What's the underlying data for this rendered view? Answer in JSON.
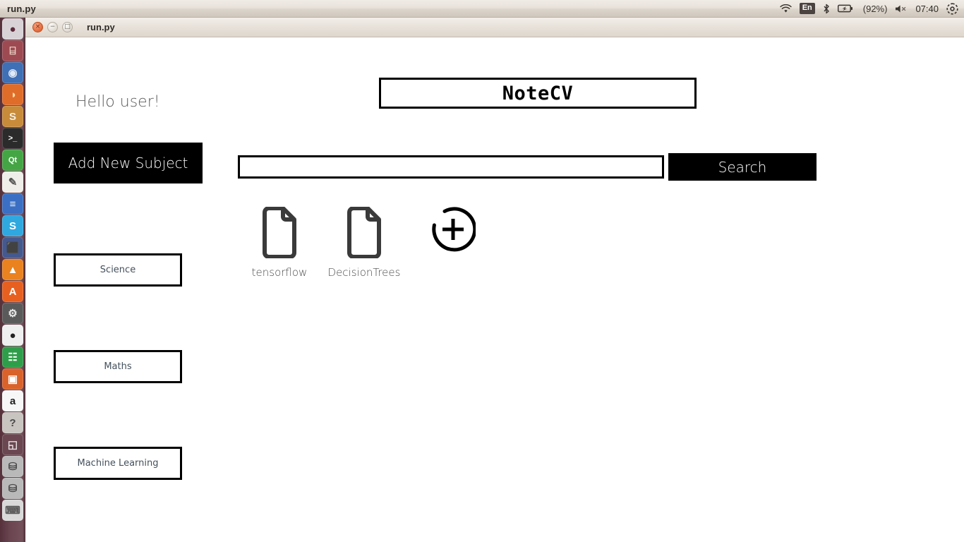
{
  "top_panel": {
    "window_title": "run.py",
    "tray": {
      "wifi_icon": "wifi-icon",
      "keyboard_layout": "En",
      "bluetooth_icon": "bluetooth-icon",
      "battery_icon": "battery-icon",
      "battery_percent": "(92%)",
      "volume_icon": "volume-muted-icon",
      "clock": "07:40",
      "settings_icon": "gear-icon"
    }
  },
  "launcher": {
    "items": [
      {
        "name": "ubuntu-dash",
        "glyph": "●",
        "bg": "#d8d2d6",
        "fg": "#5c2a3a"
      },
      {
        "name": "files-archive",
        "glyph": "⌸",
        "bg": "#9e4a52",
        "fg": "#f3e2d2"
      },
      {
        "name": "chromium-browser",
        "glyph": "◉",
        "bg": "#3f6fb5",
        "fg": "#dfe9f7"
      },
      {
        "name": "firefox-browser",
        "glyph": "◑",
        "bg": "#e06c2a",
        "fg": "#ffd9a0"
      },
      {
        "name": "sublime-text",
        "glyph": "S",
        "bg": "#c88b3a",
        "fg": "#f7efe0"
      },
      {
        "name": "terminal",
        "glyph": ">_",
        "bg": "#2b2b2b",
        "fg": "#ffffff"
      },
      {
        "name": "qt-creator",
        "glyph": "Qt",
        "bg": "#44a544",
        "fg": "#ffffff"
      },
      {
        "name": "text-editor",
        "glyph": "✎",
        "bg": "#f0eee9",
        "fg": "#555555"
      },
      {
        "name": "libreoffice-writer",
        "glyph": "≡",
        "bg": "#3a6fc4",
        "fg": "#eaf1fb"
      },
      {
        "name": "skype",
        "glyph": "S",
        "bg": "#2fa8e0",
        "fg": "#ffffff"
      },
      {
        "name": "virtualbox",
        "glyph": "⬛",
        "bg": "#44598f",
        "fg": "#dbe3f2"
      },
      {
        "name": "vlc-media-player",
        "glyph": "▲",
        "bg": "#e9821f",
        "fg": "#ffffff"
      },
      {
        "name": "ubuntu-software",
        "glyph": "A",
        "bg": "#e8601f",
        "fg": "#ffffff"
      },
      {
        "name": "system-settings",
        "glyph": "⚙",
        "bg": "#5a5a5a",
        "fg": "#e8e8e8"
      },
      {
        "name": "pinguy-builder",
        "glyph": "●",
        "bg": "#efefef",
        "fg": "#222222"
      },
      {
        "name": "libreoffice-calc",
        "glyph": "☷",
        "bg": "#2f9e4a",
        "fg": "#ffffff"
      },
      {
        "name": "libreoffice-impress",
        "glyph": "▣",
        "bg": "#d9622b",
        "fg": "#ffffff"
      },
      {
        "name": "amazon",
        "glyph": "a",
        "bg": "#f7f7f7",
        "fg": "#222222"
      },
      {
        "name": "help-unknown",
        "glyph": "?",
        "bg": "#c8c4c0",
        "fg": "#4a4a4a"
      },
      {
        "name": "workspace-switcher",
        "glyph": "◱",
        "bg": "#6a4751",
        "fg": "#e6dde0"
      },
      {
        "name": "disk-drive-1",
        "glyph": "⛁",
        "bg": "#b9b9b9",
        "fg": "#4a4a4a"
      },
      {
        "name": "disk-drive-2",
        "glyph": "⛁",
        "bg": "#b9b9b9",
        "fg": "#4a4a4a"
      },
      {
        "name": "trash",
        "glyph": "⌨",
        "bg": "#d9d9d9",
        "fg": "#5a5a5a"
      }
    ]
  },
  "window": {
    "title": "run.py",
    "controls": {
      "close": "×",
      "minimize": "−",
      "maximize": "□"
    }
  },
  "app": {
    "greeting": "Hello user!",
    "app_title": "NoteCV",
    "add_subject_label": "Add New Subject",
    "search": {
      "value": "",
      "placeholder": "",
      "button_label": "Search"
    },
    "subjects": [
      {
        "label": "Science"
      },
      {
        "label": "Maths"
      },
      {
        "label": "Machine Learning"
      }
    ],
    "notes": [
      {
        "label": "tensorflow",
        "icon": "document-icon"
      },
      {
        "label": "DecisionTrees",
        "icon": "document-icon"
      }
    ],
    "add_note_icon": "plus-circle-icon"
  },
  "colors": {
    "accent_black": "#000000",
    "page_bg": "#ffffff",
    "doc_icon": "#3a3a3a",
    "subject_text": "#44505c",
    "launcher_bg": "#6b4651"
  }
}
